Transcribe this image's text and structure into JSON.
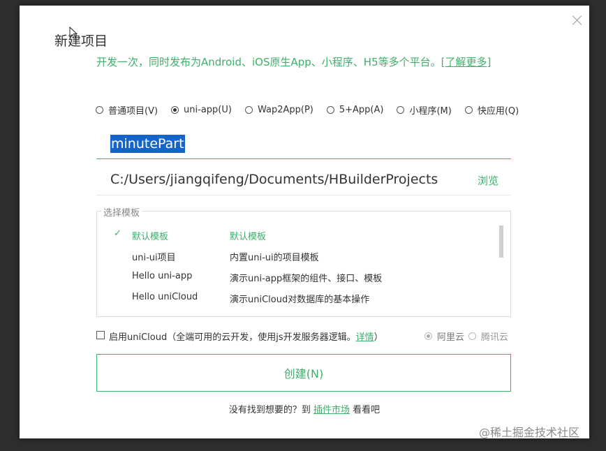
{
  "dialog": {
    "title": "新建项目",
    "subtitle_text": "开发一次，同时发布为Android、iOS原生App、小程序、H5等多个平台。",
    "subtitle_link": "[了解更多]"
  },
  "project_types": [
    {
      "label": "普通项目(V)",
      "selected": false
    },
    {
      "label": "uni-app(U)",
      "selected": true
    },
    {
      "label": "Wap2App(P)",
      "selected": false
    },
    {
      "label": "5+App(A)",
      "selected": false
    },
    {
      "label": "小程序(M)",
      "selected": false
    },
    {
      "label": "快应用(Q)",
      "selected": false
    }
  ],
  "project_name": {
    "value": "minutePart"
  },
  "location": {
    "path": "C:/Users/jiangqifeng/Documents/HBuilderProjects",
    "browse_label": "浏览"
  },
  "templates": {
    "legend": "选择模板",
    "check_mark": "✓",
    "items": [
      {
        "name": "默认模板",
        "description": "默认模板",
        "selected": true
      },
      {
        "name": "uni-ui项目",
        "description": "内置uni-ui的项目模板",
        "selected": false
      },
      {
        "name": "Hello uni-app",
        "description": "演示uni-app框架的组件、接口、模板",
        "selected": false
      },
      {
        "name": "Hello uniCloud",
        "description": "演示uniCloud对数据库的基本操作",
        "selected": false
      }
    ]
  },
  "unicloud": {
    "checked": false,
    "label": "启用uniCloud（全端可用的云开发，使用js开发服务器逻辑。",
    "details_link": "详情",
    "label_end": "）",
    "providers": [
      {
        "label": "阿里云",
        "selected": true
      },
      {
        "label": "腾讯云",
        "selected": false
      }
    ]
  },
  "create_button": {
    "label": "创建(N)"
  },
  "footer": {
    "text_before": "没有找到想要的？到 ",
    "link": "插件市场",
    "text_after": " 看看吧"
  },
  "watermark": "@稀土掘金技术社区",
  "colors": {
    "accent": "#3db06a",
    "selection": "#1565c8"
  }
}
